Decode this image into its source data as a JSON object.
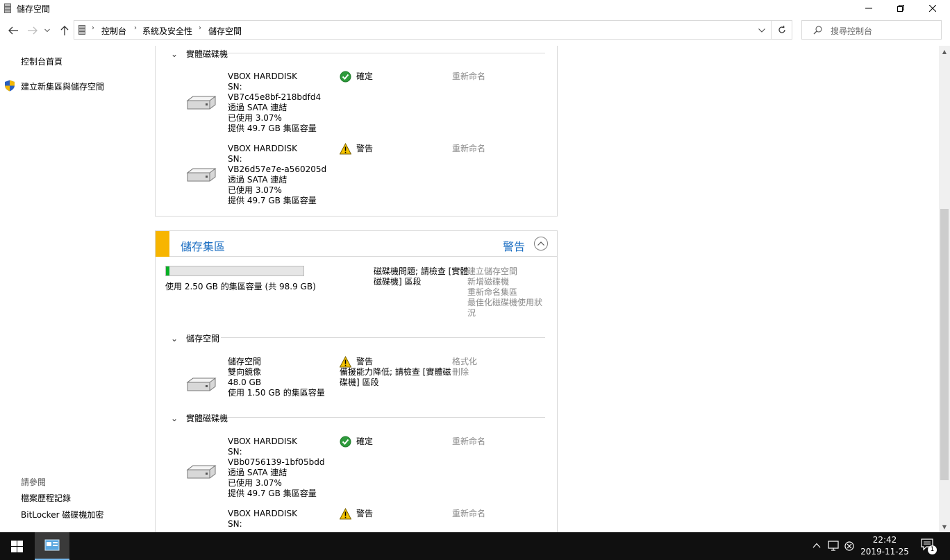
{
  "window": {
    "title": "儲存空間"
  },
  "address": {
    "crumbs": [
      "控制台",
      "系統及安全性",
      "儲存空間"
    ],
    "search_placeholder": "搜尋控制台"
  },
  "sidebar": {
    "home": "控制台首頁",
    "create_pool": "建立新集區與儲存空間",
    "see_also": "請參閱",
    "file_history": "檔案歷程記錄",
    "bitlocker": "BitLocker 磁碟機加密"
  },
  "panel1": {
    "physical_header": "實體磁碟機",
    "disks": [
      {
        "name": "VBOX HARDDISK",
        "sn_label": "SN:",
        "sn": "VB7c45e8bf-218bdfd4",
        "conn": "透過 SATA 連結",
        "used": "已使用 3.07%",
        "provide": "提供 49.7 GB 集區容量",
        "status": "確定",
        "status_type": "ok",
        "action": "重新命名"
      },
      {
        "name": "VBOX HARDDISK",
        "sn_label": "SN:",
        "sn": "VB26d57e7e-a560205d",
        "conn": "透過 SATA 連結",
        "used": "已使用 3.07%",
        "provide": "提供 49.7 GB 集區容量",
        "status": "警告",
        "status_type": "warning",
        "action": "重新命名"
      }
    ]
  },
  "pool": {
    "title": "儲存集區",
    "status": "警告",
    "usage_text": "使用 2.50 GB 的集區容量 (共 98.9 GB)",
    "usage_fraction": 0.025,
    "message_line1": "磁碟機問題; 請檢查 [實體",
    "message_line2": "磁碟機] 區段",
    "actions": [
      "建立儲存空間",
      "新增磁碟機",
      "重新命名集區",
      "最佳化磁碟機使用狀",
      "況"
    ],
    "spaces_header": "儲存空間",
    "space": {
      "name": "儲存空間",
      "type": "雙向鏡像",
      "size": "48.0 GB",
      "used": "使用 1.50 GB 的集區容量",
      "status": "警告",
      "detail_line1": "備援能力降低; 請檢查 [實體磁",
      "detail_line2": "碟機] 區段",
      "action_format": "格式化",
      "action_delete": "刪除"
    },
    "physical_header": "實體磁碟機",
    "disks": [
      {
        "name": "VBOX HARDDISK",
        "sn_label": "SN:",
        "sn": "VBb0756139-1bf05bdd",
        "conn": "透過 SATA 連結",
        "used": "已使用 3.07%",
        "provide": "提供 49.7 GB 集區容量",
        "status": "確定",
        "status_type": "ok",
        "action": "重新命名"
      },
      {
        "name": "VBOX HARDDISK",
        "sn_label": "SN:",
        "status": "警告",
        "status_type": "warning",
        "action": "重新命名"
      }
    ]
  },
  "taskbar": {
    "time": "22:42",
    "date": "2019-11-25",
    "notification_count": "1"
  }
}
